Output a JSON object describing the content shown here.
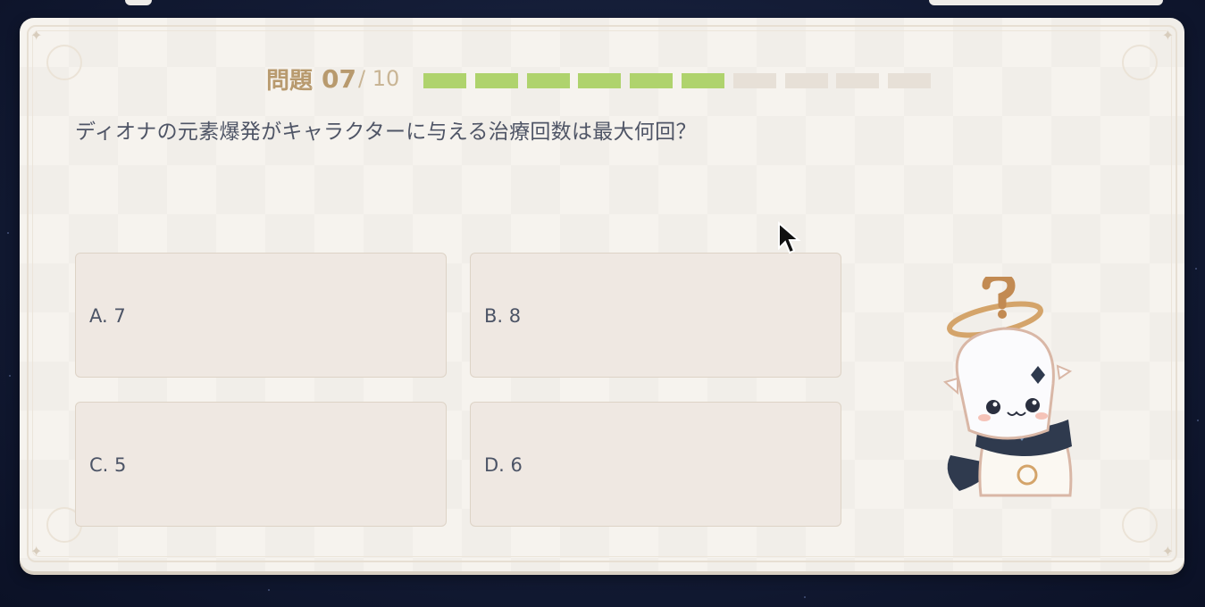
{
  "quiz": {
    "label": "問題",
    "current": "07",
    "total": "/ 10",
    "progress": {
      "completed": 6,
      "total": 10
    },
    "question": "ディオナの元素爆発がキャラクターに与える治療回数は最大何回？",
    "options": [
      {
        "label": "A. 7"
      },
      {
        "label": "B. 8"
      },
      {
        "label": "C. 5"
      },
      {
        "label": "D. 6"
      }
    ]
  },
  "colors": {
    "progress_done": "#afd36d",
    "progress_pending": "#e7e0d7",
    "label_gold": "#b89a6e"
  },
  "icons": {
    "mascot": "paimon-mascot-icon",
    "cursor": "mouse-cursor-icon"
  }
}
